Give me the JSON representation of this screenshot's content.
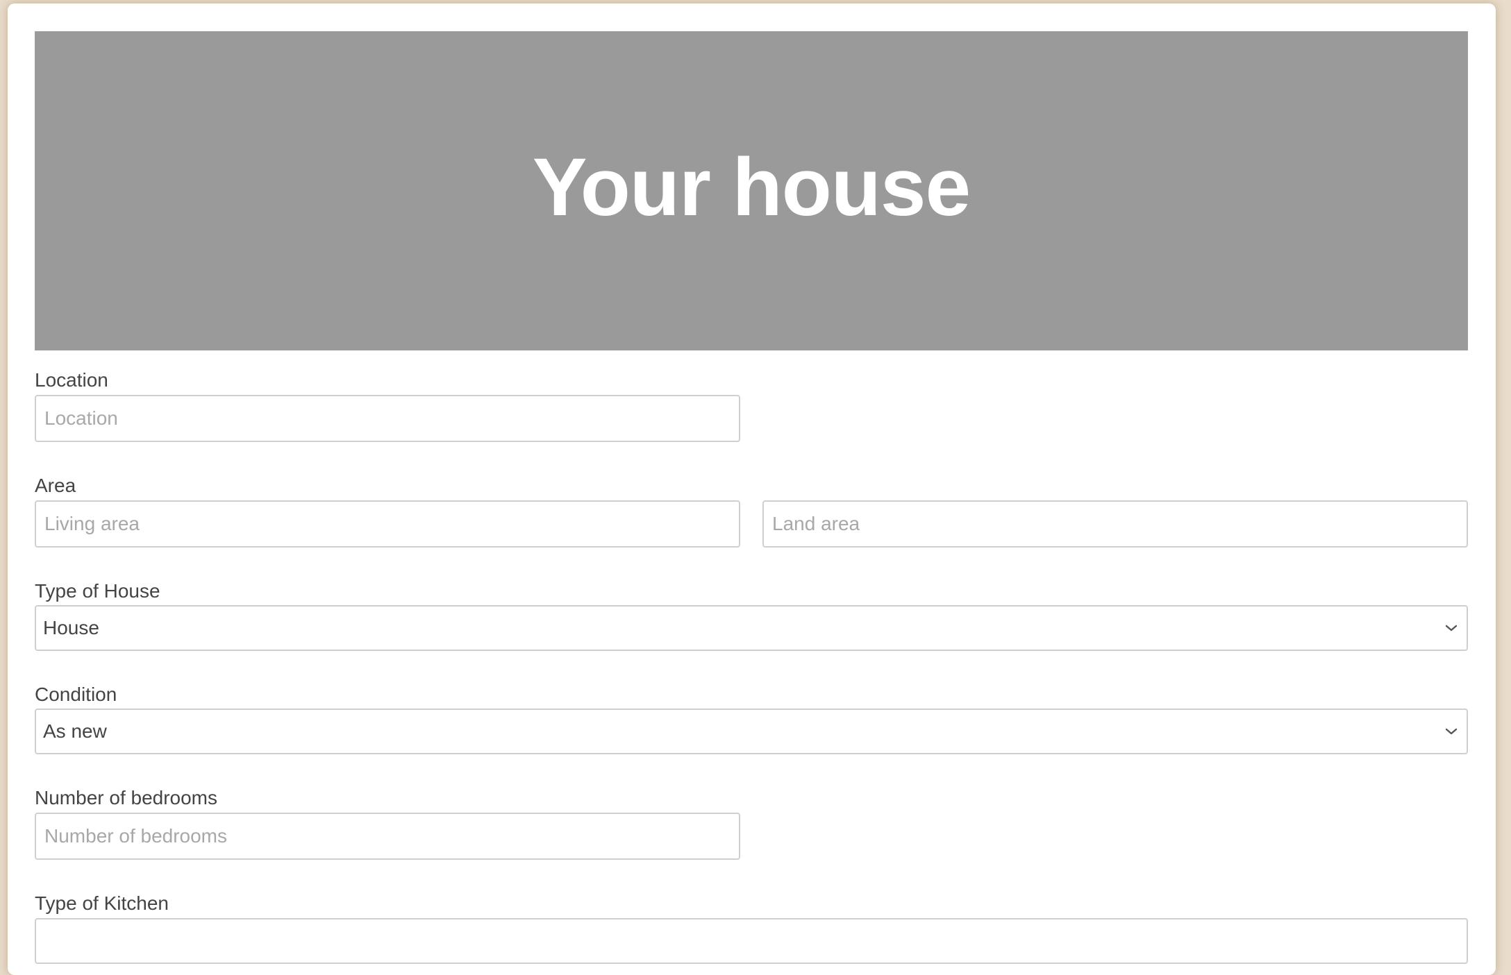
{
  "hero": {
    "title": "Your house"
  },
  "form": {
    "location": {
      "label": "Location",
      "placeholder": "Location"
    },
    "area": {
      "label": "Area",
      "living_placeholder": "Living area",
      "land_placeholder": "Land area"
    },
    "house_type": {
      "label": "Type of House",
      "value": "House"
    },
    "condition": {
      "label": "Condition",
      "value": "As new"
    },
    "bedrooms": {
      "label": "Number of bedrooms",
      "placeholder": "Number of bedrooms"
    },
    "kitchen_type": {
      "label": "Type of Kitchen"
    }
  },
  "icons": {
    "select_arrow": "chevron-down-icon"
  },
  "colors": {
    "background": "#e9dccb",
    "hero": "#9a9a9a",
    "text": "#444444",
    "placeholder": "#a8a8a8",
    "border": "#cfcfcf"
  }
}
